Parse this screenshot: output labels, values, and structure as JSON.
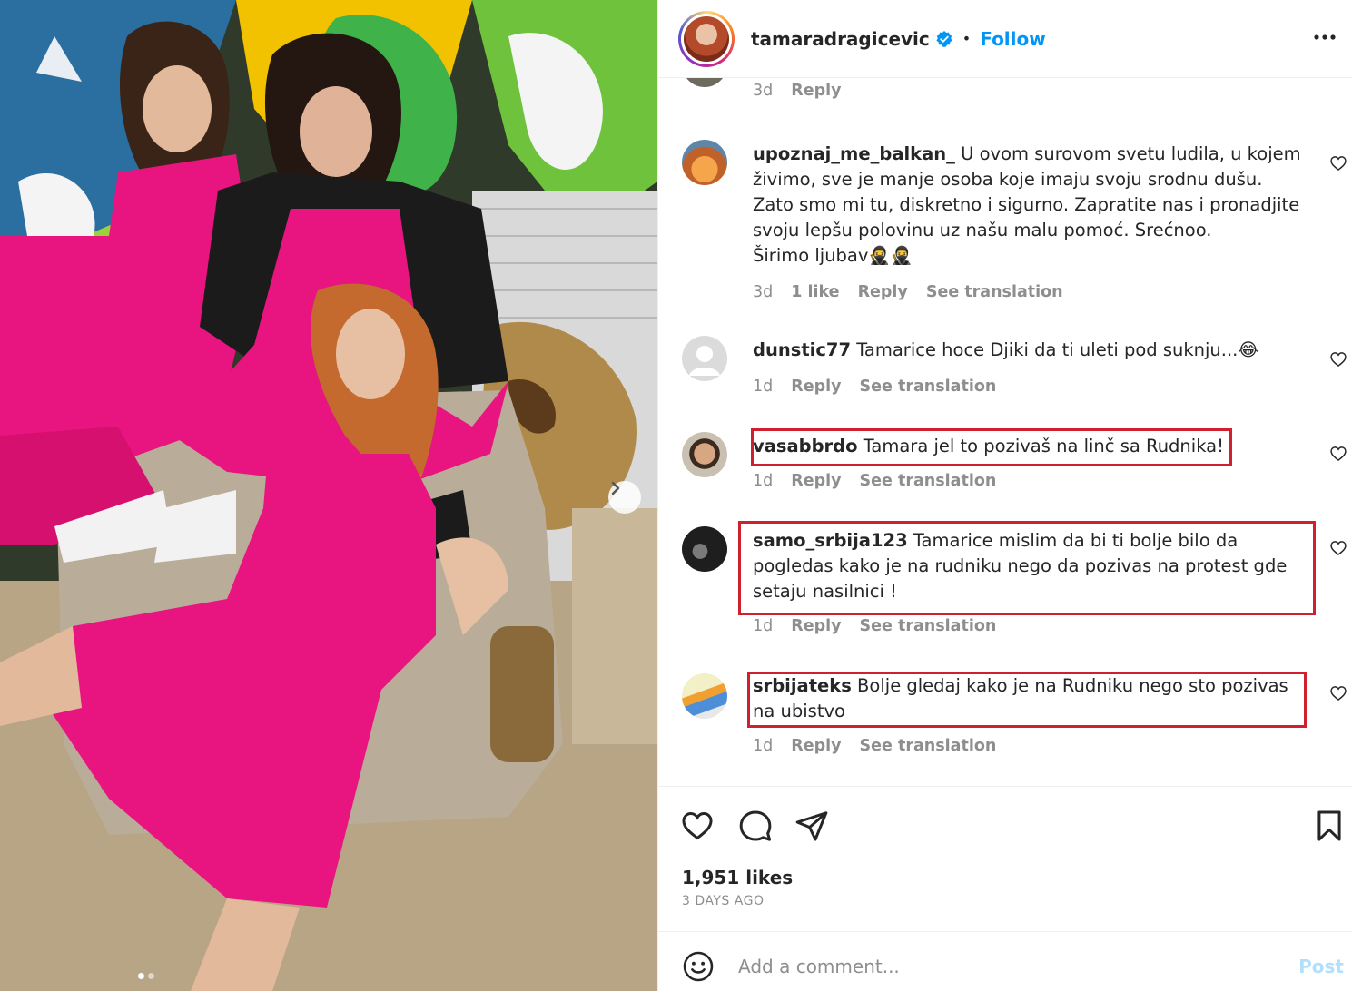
{
  "post": {
    "username": "tamaradragicevic",
    "follow_label": "Follow",
    "separator": "•",
    "likes": "1,951 likes",
    "posted_ago": "3 DAYS AGO",
    "carousel_dots": 2,
    "carousel_active": 0
  },
  "icons": {
    "verified": "verified-badge-icon",
    "more": "more-options-icon",
    "next": "chevron-right-icon",
    "like": "heart-icon",
    "comment": "comment-icon",
    "share": "send-icon",
    "save": "bookmark-icon",
    "emoji": "emoji-icon"
  },
  "comments": [
    {
      "id": "partial",
      "username": "",
      "text": "",
      "time": "3d",
      "likes": "",
      "reply": "Reply",
      "see_translation": "",
      "highlighted": false
    },
    {
      "id": "upoznaj",
      "username": "upoznaj_me_balkan_",
      "text": "U ovom surovom svetu ludila, u kojem živimo, sve je manje osoba koje imaju svoju srodnu dušu. Zato smo mi tu, diskretno i sigurno. Zapratite nas i pronadjite svoju lepšu polovinu uz našu malu pomoć. Srećnoo.",
      "text2": "Širimo ljubav🥷🥷",
      "time": "3d",
      "likes": "1 like",
      "reply": "Reply",
      "see_translation": "See translation",
      "highlighted": false
    },
    {
      "id": "dunstic",
      "username": "dunstic77",
      "text": "Tamarice hoce Djiki da ti uleti pod suknju...😂",
      "time": "1d",
      "likes": "",
      "reply": "Reply",
      "see_translation": "See translation",
      "highlighted": false
    },
    {
      "id": "vasabbrdo",
      "username": "vasabbrdo",
      "text": "Tamara jel to pozivaš na linč sa Rudnika!",
      "time": "1d",
      "likes": "",
      "reply": "Reply",
      "see_translation": "See translation",
      "highlighted": true
    },
    {
      "id": "samo",
      "username": "samo_srbija123",
      "text": "Tamarice mislim da bi ti bolje bilo da pogledas kako je na rudniku nego da pozivas na protest gde setaju nasilnici !",
      "time": "1d",
      "likes": "",
      "reply": "Reply",
      "see_translation": "See translation",
      "highlighted": true
    },
    {
      "id": "srbijateks",
      "username": "srbijateks",
      "text": "Bolje gledaj kako je na Rudniku nego sto pozivas na ubistvo",
      "time": "1d",
      "likes": "",
      "reply": "Reply",
      "see_translation": "See translation",
      "highlighted": true
    }
  ],
  "composer": {
    "placeholder": "Add a comment...",
    "post_label": "Post"
  },
  "colors": {
    "link_blue": "#0095f6",
    "highlight_red": "#d0202e",
    "dress_pink": "#e8147f",
    "muted_text": "#8e8e8e"
  }
}
